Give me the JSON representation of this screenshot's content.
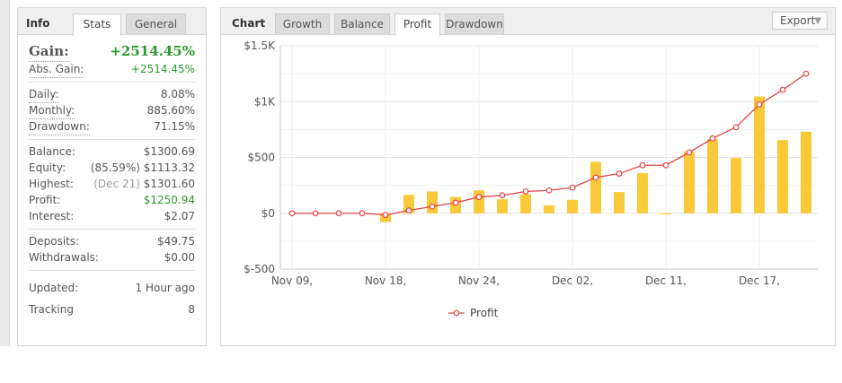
{
  "info": {
    "tabs": [
      {
        "label": "Info",
        "active": false
      },
      {
        "label": "Stats",
        "active": true
      },
      {
        "label": "General",
        "active": false
      }
    ],
    "gain": {
      "label": "Gain:",
      "value": "+2514.45%"
    },
    "abs_gain": {
      "label": "Abs. Gain:",
      "value": "+2514.45%"
    },
    "daily": {
      "label": "Daily:",
      "value": "8.08%"
    },
    "monthly": {
      "label": "Monthly:",
      "value": "885.60%"
    },
    "drawdown": {
      "label": "Drawdown:",
      "value": "71.15%"
    },
    "balance": {
      "label": "Balance:",
      "value": "$1300.69"
    },
    "equity": {
      "label": "Equity:",
      "note": "(85.59%)",
      "value": "$1113.32"
    },
    "highest": {
      "label": "Highest:",
      "note": "(Dec 21)",
      "value": "$1301.60"
    },
    "profit": {
      "label": "Profit:",
      "value": "$1250.94"
    },
    "interest": {
      "label": "Interest:",
      "value": "$2.07"
    },
    "deposits": {
      "label": "Deposits:",
      "value": "$49.75"
    },
    "withdrawals": {
      "label": "Withdrawals:",
      "value": "$0.00"
    },
    "updated": {
      "label": "Updated:",
      "value": "1 Hour ago"
    },
    "tracking": {
      "label": "Tracking",
      "value": "8"
    }
  },
  "chart_panel": {
    "title": "Chart",
    "tabs": [
      {
        "label": "Growth",
        "active": false
      },
      {
        "label": "Balance",
        "active": false
      },
      {
        "label": "Profit",
        "active": true
      },
      {
        "label": "Drawdown",
        "active": false
      }
    ],
    "export_label": "Export",
    "export_icon": "caret-down-icon"
  },
  "colors": {
    "bar": "#f9c93a",
    "line": "#e54444",
    "gain_green": "#2a9a2a"
  },
  "chart_data": {
    "type": "bar",
    "title": "",
    "ylabel": "",
    "xlabel": "",
    "ylim": [
      -500,
      1500
    ],
    "y_ticks": [
      -500,
      0,
      500,
      1000,
      1500
    ],
    "y_tick_labels": [
      "$-500",
      "$0",
      "$500",
      "$1K",
      "$1.5K"
    ],
    "x_tick_labels": [
      "Nov 09,",
      "Nov 18,",
      "Nov 24,",
      "Dec 02,",
      "Dec 11,",
      "Dec 17,"
    ],
    "x_tick_indices": [
      0,
      4,
      8,
      12,
      16,
      20
    ],
    "grid": true,
    "legend_position": "bottom-center",
    "series": [
      {
        "name": "",
        "type": "bar",
        "values": [
          0,
          0,
          0,
          0,
          -80,
          165,
          195,
          145,
          205,
          125,
          170,
          70,
          120,
          460,
          190,
          360,
          -10,
          555,
          665,
          495,
          1045,
          655,
          730
        ]
      },
      {
        "name": "Profit",
        "type": "line",
        "values": [
          0,
          0,
          0,
          0,
          -15,
          25,
          60,
          95,
          145,
          160,
          195,
          205,
          230,
          320,
          355,
          430,
          430,
          545,
          670,
          770,
          975,
          1105,
          1250
        ]
      }
    ]
  }
}
